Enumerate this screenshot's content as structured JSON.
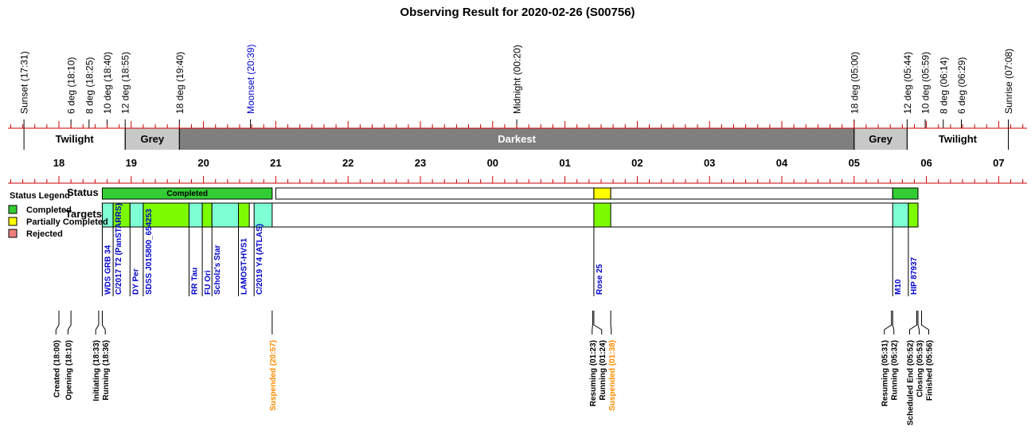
{
  "chart_data": {
    "type": "timeline",
    "title": "Observing Result for 2020-02-26 (S00756)",
    "time_axis": {
      "hour_labels": [
        "18",
        "19",
        "20",
        "21",
        "22",
        "23",
        "00",
        "01",
        "02",
        "03",
        "04",
        "05",
        "06",
        "07"
      ],
      "range": [
        "17:31",
        "07:08"
      ]
    },
    "sky_events": [
      {
        "label": "Sunset (17:31)",
        "time": "17:31",
        "color": "#000000"
      },
      {
        "label": "6 deg (18:10)",
        "time": "18:10",
        "color": "#000000"
      },
      {
        "label": "8 deg (18:25)",
        "time": "18:25",
        "color": "#000000"
      },
      {
        "label": "10 deg (18:40)",
        "time": "18:40",
        "color": "#000000"
      },
      {
        "label": "12 deg (18:55)",
        "time": "18:55",
        "color": "#000000"
      },
      {
        "label": "18 deg (19:40)",
        "time": "19:40",
        "color": "#000000"
      },
      {
        "label": "Moonset (20:39)",
        "time": "20:39",
        "color": "#0000cc"
      },
      {
        "label": "Midnight (00:20)",
        "time": "00:20",
        "color": "#000000"
      },
      {
        "label": "18 deg (05:00)",
        "time": "05:00",
        "color": "#000000"
      },
      {
        "label": "12 deg (05:44)",
        "time": "05:44",
        "color": "#000000"
      },
      {
        "label": "10 deg (05:59)",
        "time": "05:59",
        "color": "#000000"
      },
      {
        "label": "8 deg (06:14)",
        "time": "06:14",
        "color": "#000000"
      },
      {
        "label": "6 deg (06:29)",
        "time": "06:29",
        "color": "#000000"
      },
      {
        "label": "Sunrise (07:08)",
        "time": "07:08",
        "color": "#000000"
      }
    ],
    "sky_bands": [
      {
        "label": "Twilight",
        "start": "17:31",
        "end": "18:55",
        "color": "#ffffff",
        "text_color": "#000000"
      },
      {
        "label": "Grey",
        "start": "18:55",
        "end": "19:40",
        "color": "#c8c8c8",
        "text_color": "#000000"
      },
      {
        "label": "Darkest",
        "start": "19:40",
        "end": "05:00",
        "color": "#7f7f7f",
        "text_color": "#ffffff"
      },
      {
        "label": "Grey",
        "start": "05:00",
        "end": "05:44",
        "color": "#c8c8c8",
        "text_color": "#000000"
      },
      {
        "label": "Twilight",
        "start": "05:44",
        "end": "07:08",
        "color": "#ffffff",
        "text_color": "#000000"
      }
    ],
    "status_row": {
      "label": "Status",
      "segments": [
        {
          "start": "18:36",
          "end": "20:57",
          "status": "Completed",
          "text": "Completed"
        },
        {
          "start": "21:00",
          "end": "01:24",
          "status": "None",
          "text": ""
        },
        {
          "start": "01:24",
          "end": "01:38",
          "status": "Partially Completed",
          "text": ""
        },
        {
          "start": "01:38",
          "end": "05:32",
          "status": "None",
          "text": ""
        },
        {
          "start": "05:32",
          "end": "05:53",
          "status": "Completed",
          "text": ""
        }
      ]
    },
    "targets_row": {
      "label": "Targets",
      "segments": [
        {
          "name": "WDS GRB 34",
          "start": "18:36",
          "end": "18:45",
          "color": "#7fffd4"
        },
        {
          "name": "C/2017 T2 (PanSTARRS)",
          "start": "18:45",
          "end": "18:59",
          "color": "#7cfc00"
        },
        {
          "name": "DY Per",
          "start": "18:59",
          "end": "19:10",
          "color": "#7fffd4"
        },
        {
          "name": "SDSS J015800_654253",
          "start": "19:10",
          "end": "19:48",
          "color": "#7cfc00"
        },
        {
          "name": "RR Tau",
          "start": "19:48",
          "end": "19:59",
          "color": "#7fffd4"
        },
        {
          "name": "FU Ori",
          "start": "19:59",
          "end": "20:07",
          "color": "#7cfc00"
        },
        {
          "name": "Scholz's Star",
          "start": "20:07",
          "end": "20:29",
          "color": "#7fffd4"
        },
        {
          "name": "LAMOST-HVS1",
          "start": "20:29",
          "end": "20:38",
          "color": "#7cfc00"
        },
        {
          "name": "C/2019 Y4 (ATLAS)",
          "start": "20:42",
          "end": "20:57",
          "color": "#7fffd4"
        },
        {
          "name": "Rose 25",
          "start": "01:24",
          "end": "01:38",
          "color": "#7cfc00"
        },
        {
          "name": "M10",
          "start": "05:32",
          "end": "05:45",
          "color": "#7fffd4"
        },
        {
          "name": "HIP 87937",
          "start": "05:45",
          "end": "05:53",
          "color": "#7cfc00"
        }
      ]
    },
    "legend": {
      "title": "Status Legend",
      "position": "left",
      "items": [
        {
          "label": "Completed",
          "color": "#33cc33"
        },
        {
          "label": "Partially Completed",
          "color": "#ffff00"
        },
        {
          "label": "Rejected",
          "color": "#f08080"
        }
      ]
    },
    "log_events": [
      {
        "label": "Created (18:00)",
        "time": "18:00",
        "color": "#000000"
      },
      {
        "label": "Opening (18:10)",
        "time": "18:10",
        "color": "#000000"
      },
      {
        "label": "Initiating (18:33)",
        "time": "18:33",
        "color": "#000000"
      },
      {
        "label": "Running (18:36)",
        "time": "18:36",
        "color": "#000000"
      },
      {
        "label": "Suspended (20:57)",
        "time": "20:57",
        "color": "#ff8c00"
      },
      {
        "label": "Resuming (01:23)",
        "time": "01:23",
        "color": "#000000"
      },
      {
        "label": "Running (01:24)",
        "time": "01:24",
        "color": "#000000"
      },
      {
        "label": "Suspended (01:38)",
        "time": "01:38",
        "color": "#ff8c00"
      },
      {
        "label": "Resuming (05:31)",
        "time": "05:31",
        "color": "#000000"
      },
      {
        "label": "Running (05:32)",
        "time": "05:32",
        "color": "#000000"
      },
      {
        "label": "Scheduled End (05:52)",
        "time": "05:52",
        "color": "#000000"
      },
      {
        "label": "Closing (05:53)",
        "time": "05:53",
        "color": "#000000"
      },
      {
        "label": "Finished (05:56)",
        "time": "05:56",
        "color": "#000000"
      }
    ],
    "colors": {
      "axis_red": "#cc0000",
      "completed": "#33cc33",
      "partial": "#ffff00",
      "target_a": "#7fffd4",
      "target_b": "#7cfc00"
    }
  }
}
